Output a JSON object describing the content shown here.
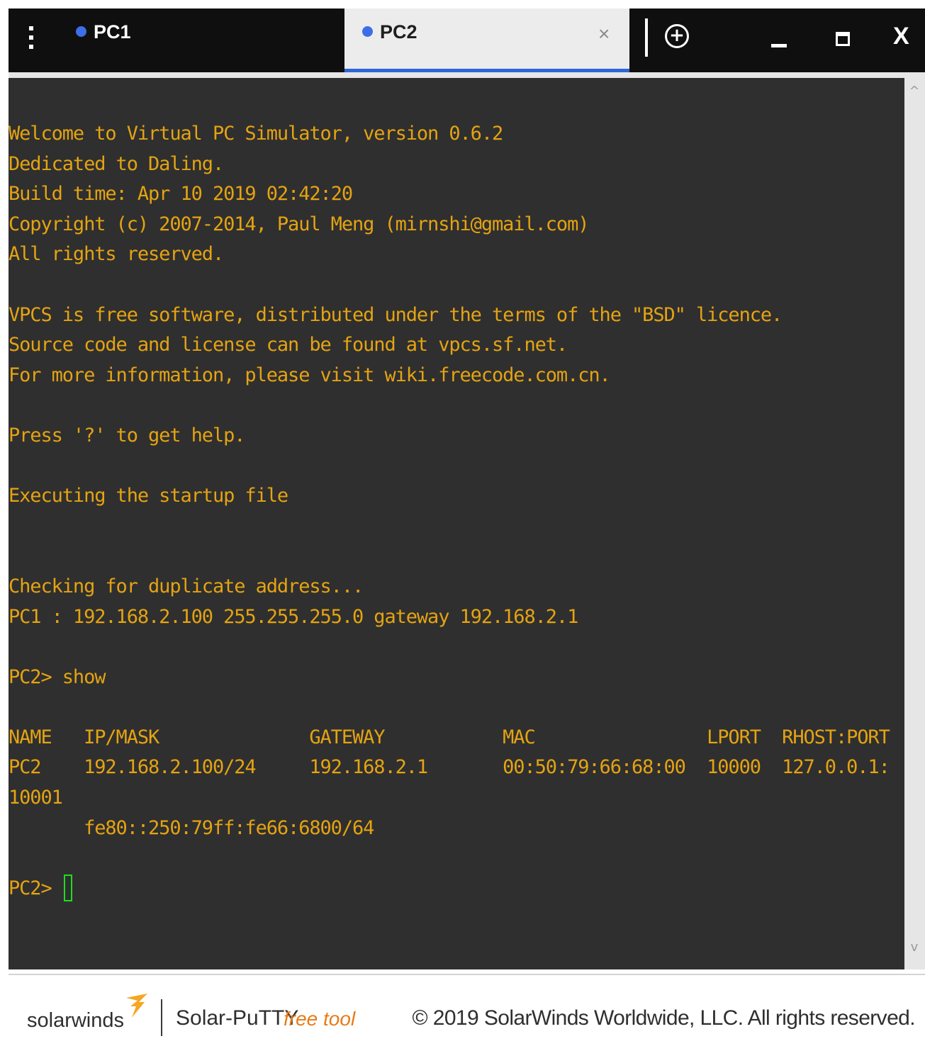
{
  "titlebar": {
    "tabs": [
      {
        "label": "PC1",
        "status_color": "#3d6ee8",
        "active": false
      },
      {
        "label": "PC2",
        "status_color": "#3d6ee8",
        "active": true
      }
    ],
    "tab_close_glyph": "×",
    "new_tab_glyph": "+",
    "close_glyph": "X",
    "icons": [
      "menu-kebab-icon",
      "tab-close-icon",
      "new-tab-icon",
      "minimize-icon",
      "maximize-icon",
      "close-icon"
    ]
  },
  "terminal": {
    "text_color": "#e4a312",
    "background": "#2f2f2f",
    "cursor_color": "#1fdc1f",
    "lines": [
      "Welcome to Virtual PC Simulator, version 0.6.2",
      "Dedicated to Daling.",
      "Build time: Apr 10 2019 02:42:20",
      "Copyright (c) 2007-2014, Paul Meng (mirnshi@gmail.com)",
      "All rights reserved.",
      "",
      "VPCS is free software, distributed under the terms of the \"BSD\" licence.",
      "Source code and license can be found at vpcs.sf.net.",
      "For more information, please visit wiki.freecode.com.cn.",
      "",
      "Press '?' to get help.",
      "",
      "Executing the startup file",
      "",
      "",
      "Checking for duplicate address...",
      "PC1 : 192.168.2.100 255.255.255.0 gateway 192.168.2.1",
      "",
      "PC2> show",
      "",
      "NAME   IP/MASK              GATEWAY           MAC                LPORT  RHOST:PORT",
      "PC2    192.168.2.100/24     192.168.2.1       00:50:79:66:68:00  10000  127.0.0.1:",
      "10001",
      "       fe80::250:79ff:fe66:6800/64",
      ""
    ],
    "prompt": "PC2> "
  },
  "scrollbar": {
    "up_glyph": "^",
    "down_glyph": "v"
  },
  "footer": {
    "brand": "solarwinds",
    "brand_accent": "#f5a623",
    "product": "Solar-PuTTY",
    "product_tag": "free tool",
    "copyright": "© 2019 SolarWinds Worldwide, LLC. All rights reserved."
  }
}
